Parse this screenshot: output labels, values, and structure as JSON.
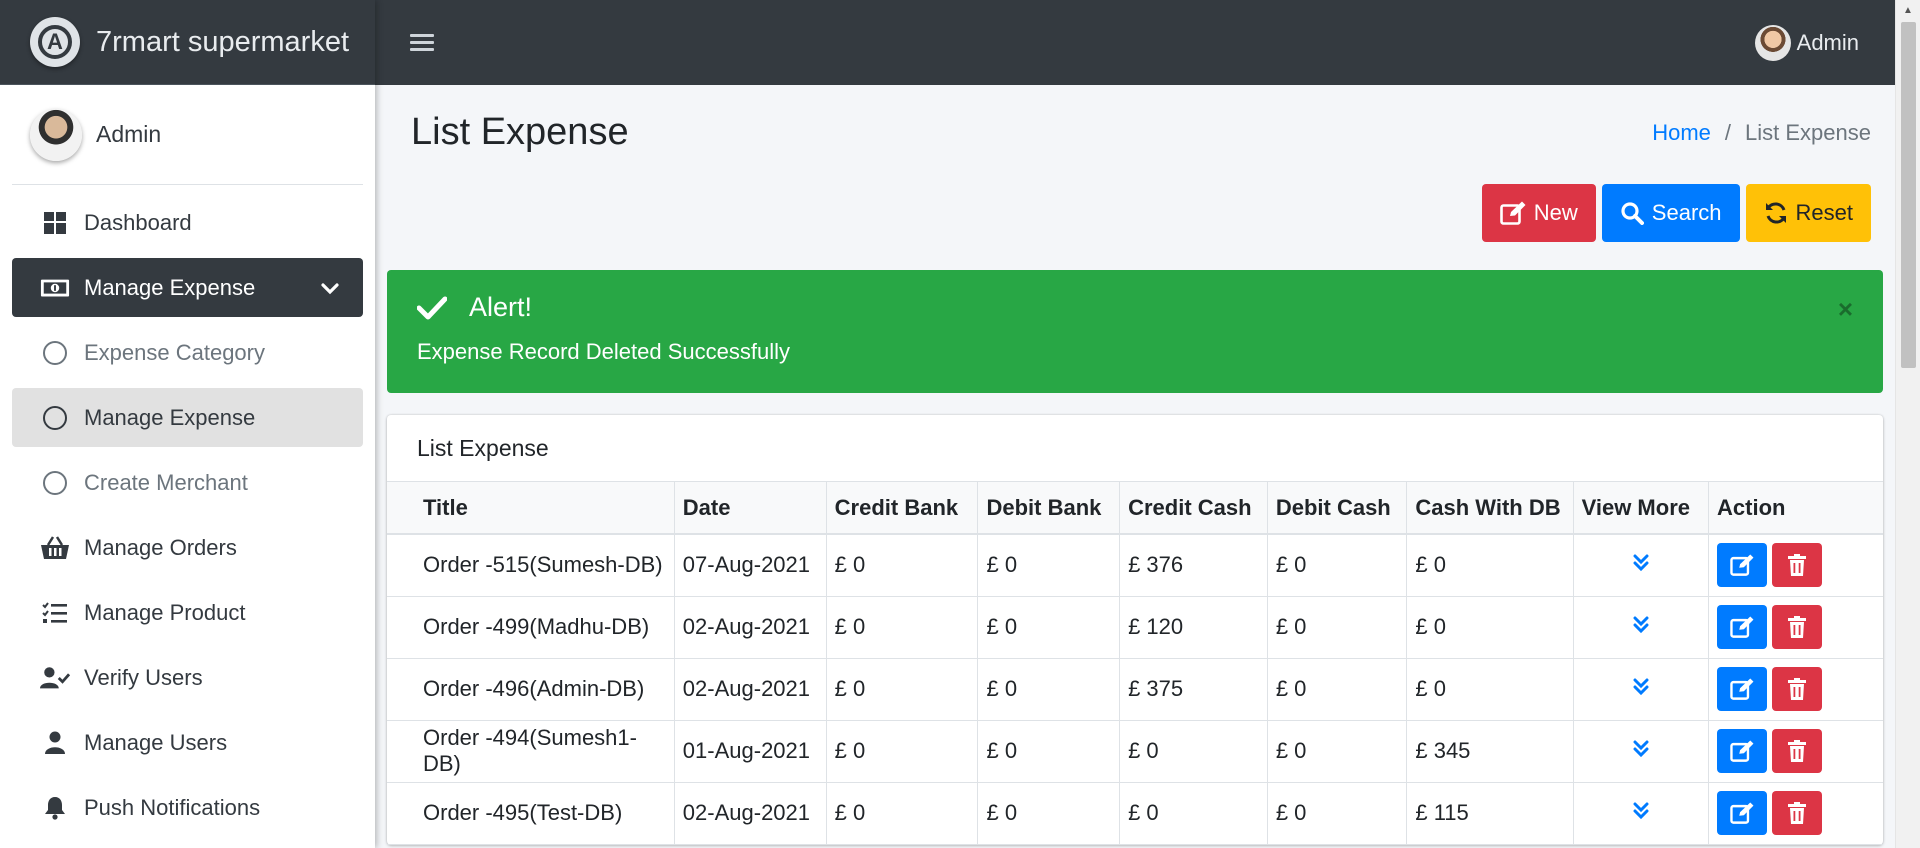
{
  "brand": {
    "name": "7rmart supermarket",
    "logo_letter": "A"
  },
  "user_panel": {
    "name": "Admin"
  },
  "topbar": {
    "user_name": "Admin"
  },
  "sidebar": {
    "items": [
      {
        "label": "Dashboard",
        "icon": "dashboard-icon"
      },
      {
        "label": "Manage Expense",
        "icon": "money-bill-icon",
        "active": true
      },
      {
        "label": "Expense Category",
        "icon": "circle-icon",
        "sub": true
      },
      {
        "label": "Manage Expense",
        "icon": "circle-icon",
        "sub": true,
        "selected": true
      },
      {
        "label": "Create Merchant",
        "icon": "circle-icon",
        "sub": true
      },
      {
        "label": "Manage Orders",
        "icon": "basket-icon"
      },
      {
        "label": "Manage Product",
        "icon": "list-check-icon"
      },
      {
        "label": "Verify Users",
        "icon": "user-check-icon"
      },
      {
        "label": "Manage Users",
        "icon": "user-icon"
      },
      {
        "label": "Push Notifications",
        "icon": "bell-icon"
      }
    ]
  },
  "page": {
    "title": "List Expense",
    "breadcrumb": {
      "home": "Home",
      "separator": "/",
      "current": "List Expense"
    }
  },
  "actions": {
    "new_label": "New",
    "search_label": "Search",
    "reset_label": "Reset"
  },
  "alert": {
    "title": "Alert!",
    "message": "Expense Record Deleted Successfully",
    "close": "×"
  },
  "card": {
    "title": "List Expense"
  },
  "table": {
    "headers": [
      "Title",
      "Date",
      "Credit Bank",
      "Debit Bank",
      "Credit Cash",
      "Debit Cash",
      "Cash With DB",
      "View More",
      "Action"
    ],
    "rows": [
      [
        "Order -515(Sumesh-DB)",
        "07-Aug-2021",
        "£ 0",
        "£ 0",
        "£ 376",
        "£ 0",
        "£ 0"
      ],
      [
        "Order -499(Madhu-DB)",
        "02-Aug-2021",
        "£ 0",
        "£ 0",
        "£ 120",
        "£ 0",
        "£ 0"
      ],
      [
        "Order -496(Admin-DB)",
        "02-Aug-2021",
        "£ 0",
        "£ 0",
        "£ 375",
        "£ 0",
        "£ 0"
      ],
      [
        "Order -494(Sumesh1-DB)",
        "01-Aug-2021",
        "£ 0",
        "£ 0",
        "£ 0",
        "£ 0",
        "£ 345"
      ],
      [
        "Order -495(Test-DB)",
        "02-Aug-2021",
        "£ 0",
        "£ 0",
        "£ 0",
        "£ 0",
        "£ 115"
      ]
    ]
  },
  "colors": {
    "navbar": "#343a40",
    "danger": "#dc3545",
    "primary": "#007bff",
    "warning": "#ffc107",
    "success": "#28a745"
  }
}
